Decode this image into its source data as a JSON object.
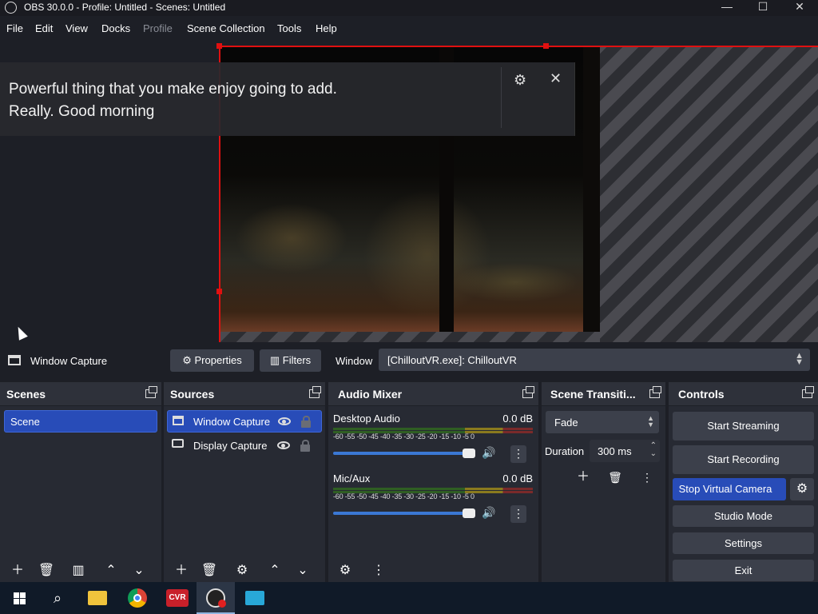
{
  "window": {
    "title": "OBS 30.0.0 - Profile: Untitled - Scenes: Untitled"
  },
  "menu": {
    "items": [
      "File",
      "Edit",
      "View",
      "Docks",
      "Profile",
      "Scene Collection",
      "Tools",
      "Help"
    ]
  },
  "notification": {
    "line1": "Powerful thing that you make enjoy going to add.",
    "line2": "Really. Good morning"
  },
  "source_bar": {
    "source_name": "Window Capture",
    "properties_label": "Properties",
    "filters_label": "Filters",
    "window_label": "Window",
    "window_value": "[ChilloutVR.exe]: ChilloutVR"
  },
  "scenes": {
    "title": "Scenes",
    "items": [
      "Scene"
    ]
  },
  "sources": {
    "title": "Sources",
    "items": [
      "Window Capture",
      "Display Capture"
    ]
  },
  "audio_mixer": {
    "title": "Audio Mixer",
    "channels": [
      {
        "name": "Desktop Audio",
        "level": "0.0 dB",
        "volume_fraction": 1.0
      },
      {
        "name": "Mic/Aux",
        "level": "0.0 dB",
        "volume_fraction": 1.0
      }
    ],
    "ticks": [
      "-60",
      "-55",
      "-50",
      "-45",
      "-40",
      "-35",
      "-30",
      "-25",
      "-20",
      "-15",
      "-10",
      "-5",
      "0"
    ]
  },
  "transitions": {
    "title": "Scene Transiti...",
    "selected": "Fade",
    "duration_label": "Duration",
    "duration_value": "300 ms"
  },
  "controls": {
    "title": "Controls",
    "start_streaming": "Start Streaming",
    "start_recording": "Start Recording",
    "stop_virtual_camera": "Stop Virtual Camera",
    "studio_mode": "Studio Mode",
    "settings": "Settings",
    "exit": "Exit"
  },
  "colors": {
    "accent": "#284cb8",
    "selection": "#e01010",
    "panel": "#272a33",
    "button": "#3c404b"
  },
  "taskbar": {
    "icons": [
      "windows-start-icon",
      "search-icon",
      "file-explorer-icon",
      "chrome-icon",
      "chilloutvr-icon",
      "obs-icon",
      "notes-app-icon"
    ]
  }
}
